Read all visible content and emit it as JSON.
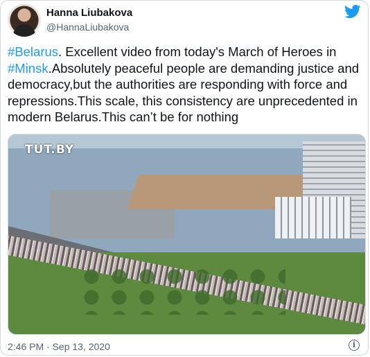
{
  "author": {
    "name": "Hanna Liubakova",
    "handle": "@HannaLiubakova"
  },
  "tweet": {
    "hashtag_1": "#Belarus",
    "text_1": ". Excellent video from today's March of Heroes in ",
    "hashtag_2": "#Minsk",
    "text_2": ".Absolutely peaceful people are demanding justice and democracy,but the authorities are responding with force and repressions.This scale, this consistency are unprecedented in modern Belarus.This can’t be for nothing"
  },
  "media": {
    "watermark": "TUT.BY",
    "description_icon": "video-thumbnail"
  },
  "timestamp": "2:46 PM · Sep 13, 2020",
  "icons": {
    "brand": "twitter-bird-icon",
    "info": "info-icon"
  },
  "colors": {
    "link": "#1d9bf0",
    "secondary_text": "#536471",
    "border": "#cfd9de"
  }
}
